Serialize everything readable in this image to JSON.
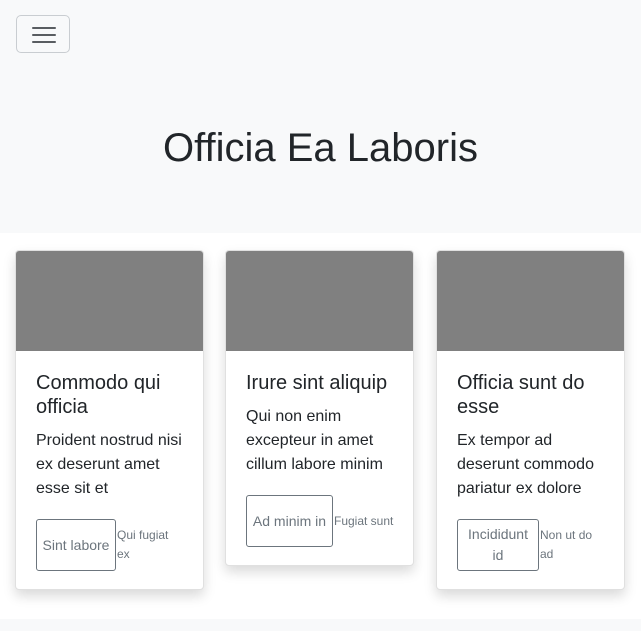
{
  "navbar": {
    "toggle_icon": "hamburger-icon"
  },
  "hero": {
    "title": "Officia Ea Laboris"
  },
  "cards": [
    {
      "image_color": "#808080",
      "title": "Commodo qui officia",
      "text": "Proident nostrud nisi ex deserunt amet esse sit et",
      "button_label": "Sint labore",
      "small_text": "Qui fugiat ex"
    },
    {
      "image_color": "#808080",
      "title": "Irure sint aliquip",
      "text": "Qui non enim excepteur in amet cillum labore minim",
      "button_label": "Ad minim in",
      "small_text": "Fugiat sunt"
    },
    {
      "image_color": "#808080",
      "title": "Officia sunt do esse",
      "text": "Ex tempor ad deserunt commodo pariatur ex dolore",
      "button_label": "Incididunt id",
      "small_text": "Non ut do ad"
    }
  ]
}
